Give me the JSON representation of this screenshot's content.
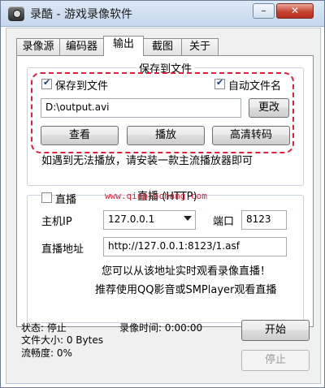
{
  "window": {
    "title": "录酷 - 游戏录像软件",
    "minimize_label": "–",
    "close_label": "✕"
  },
  "tabs": [
    {
      "label": "录像源",
      "active": false
    },
    {
      "label": "编码器",
      "active": false
    },
    {
      "label": "输出",
      "active": true
    },
    {
      "label": "截图",
      "active": false
    },
    {
      "label": "关于",
      "active": false
    }
  ],
  "save_group": {
    "title": "保存到文件",
    "save_to_file": {
      "label": "保存到文件",
      "checked": true
    },
    "auto_filename": {
      "label": "自动文件名",
      "checked": true
    },
    "path_value": "D:\\output.avi",
    "change_button": "更改",
    "view_button": "查看",
    "play_button": "播放",
    "hd_convert_button": "高清转码",
    "hint": "如遇到无法播放，请安装一款主流播放器即可"
  },
  "live_group": {
    "title": "直播 (HTTP)",
    "live_checkbox": {
      "label": "直播",
      "checked": false
    },
    "host_label": "主机IP",
    "host_value": "127.0.0.1",
    "port_label": "端口",
    "port_value": "8123",
    "url_label": "直播地址",
    "url_value": "http://127.0.0.1:8123/1.asf",
    "hint1": "您可以从该地址实时观看录像直播！",
    "hint2": "推荐使用QQ影音或SMPlayer观看直播"
  },
  "watermark": "www.qinpinchang.com",
  "status": {
    "state": "状态: 停止",
    "record_time": "录像时间: 0:00:00",
    "file_size": "文件大小: 0 Bytes",
    "fluency": "流畅度: 0%",
    "start_button": "开始",
    "stop_button": "停止"
  },
  "colors": {
    "accent_dashed": "#e0203a",
    "titlebar": "#c5d7ec",
    "close_button": "#c84531"
  }
}
